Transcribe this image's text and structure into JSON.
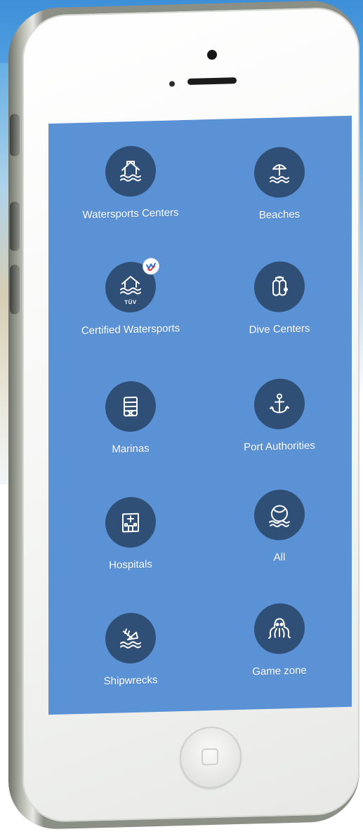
{
  "menu": {
    "items": [
      {
        "id": "watersports",
        "label": "Watersports Centers",
        "icon": "watersports-center-icon"
      },
      {
        "id": "beaches",
        "label": "Beaches",
        "icon": "beach-umbrella-icon"
      },
      {
        "id": "certified",
        "label": "Certified Watersports",
        "icon": "certified-watersports-icon",
        "badge_text": "TÜV"
      },
      {
        "id": "dive",
        "label": "Dive Centers",
        "icon": "dive-tank-icon"
      },
      {
        "id": "marinas",
        "label": "Marinas",
        "icon": "marina-icon"
      },
      {
        "id": "ports",
        "label": "Port Authorities",
        "icon": "anchor-icon"
      },
      {
        "id": "hospitals",
        "label": "Hospitals",
        "icon": "hospital-icon"
      },
      {
        "id": "all",
        "label": "All",
        "icon": "globe-waves-icon"
      },
      {
        "id": "shipwrecks",
        "label": "Shipwrecks",
        "icon": "shipwreck-icon"
      },
      {
        "id": "game",
        "label": "Game zone",
        "icon": "octopus-icon"
      }
    ]
  },
  "colors": {
    "screen_bg": "#5b92d6",
    "icon_circle": "#2f4f76",
    "label_text": "#ffffff"
  }
}
